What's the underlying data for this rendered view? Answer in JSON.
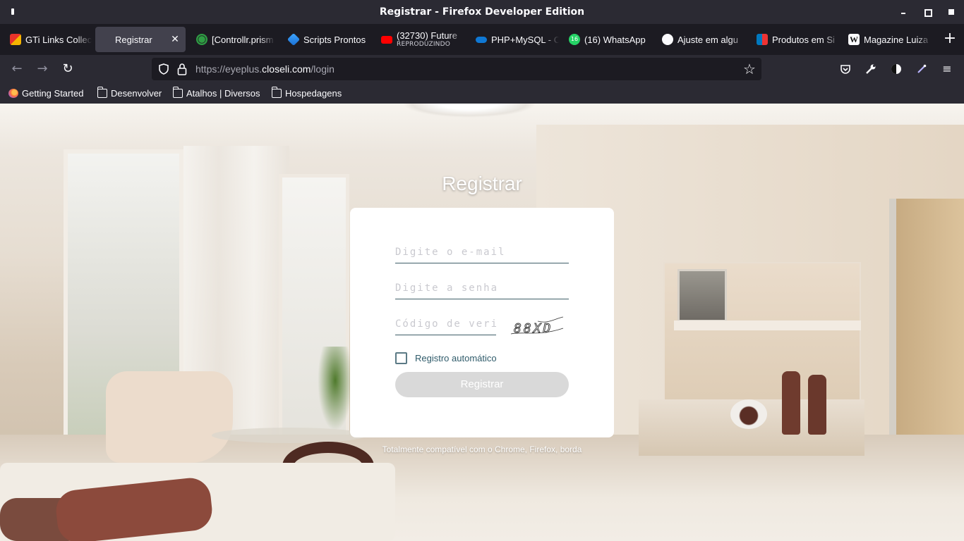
{
  "window": {
    "title": "Registrar - Firefox Developer Edition"
  },
  "tabs": [
    {
      "label": "GTi Links Collec",
      "icon": "gti-links-icon",
      "active": false
    },
    {
      "label": "Registrar",
      "icon": "blank-page-icon",
      "active": true
    },
    {
      "label": "[Controllr.prism",
      "icon": "gear-icon",
      "active": false
    },
    {
      "label": "Scripts Prontos",
      "icon": "cube-icon",
      "active": false
    },
    {
      "label": "(32730) Future",
      "sublabel": "REPRODUZINDO",
      "icon": "youtube-icon",
      "active": false
    },
    {
      "label": "PHP+MySQL - C",
      "icon": "onedrive-icon",
      "active": false
    },
    {
      "label": "(16) WhatsApp",
      "icon": "whatsapp-icon",
      "active": false
    },
    {
      "label": "Ajuste em algu",
      "icon": "github-icon",
      "active": false
    },
    {
      "label": "Produtos em Si",
      "icon": "trello-icon",
      "active": false
    },
    {
      "label": "Magazine Luiza",
      "icon": "wikipedia-icon",
      "active": false
    }
  ],
  "whatsapp_badge": "16",
  "address": {
    "prefix": "https://eyeplus.",
    "host": "closeli.com",
    "path": "/login"
  },
  "bookmarks": [
    {
      "label": "Getting Started",
      "icon": "firefox-icon"
    },
    {
      "label": "Desenvolver",
      "icon": "folder-icon"
    },
    {
      "label": "Atalhos | Diversos",
      "icon": "folder-icon"
    },
    {
      "label": "Hospedagens",
      "icon": "folder-icon"
    }
  ],
  "page": {
    "heading": "Registrar",
    "email_placeholder": "Digite o e-mail",
    "password_placeholder": "Digite a senha",
    "code_placeholder": "Código de verificação",
    "captcha_text": "88XD",
    "auto_login_label": "Registro automático",
    "submit_label": "Registrar",
    "compat_note": "Totalmente compatível com o Chrome, Firefox, borda"
  },
  "colors": {
    "chrome_dark": "#1c1b22",
    "chrome": "#2b2a33",
    "input_line": "#3f5e68",
    "label_teal": "#2f5b6a",
    "button_gray": "#d9d9d9"
  }
}
